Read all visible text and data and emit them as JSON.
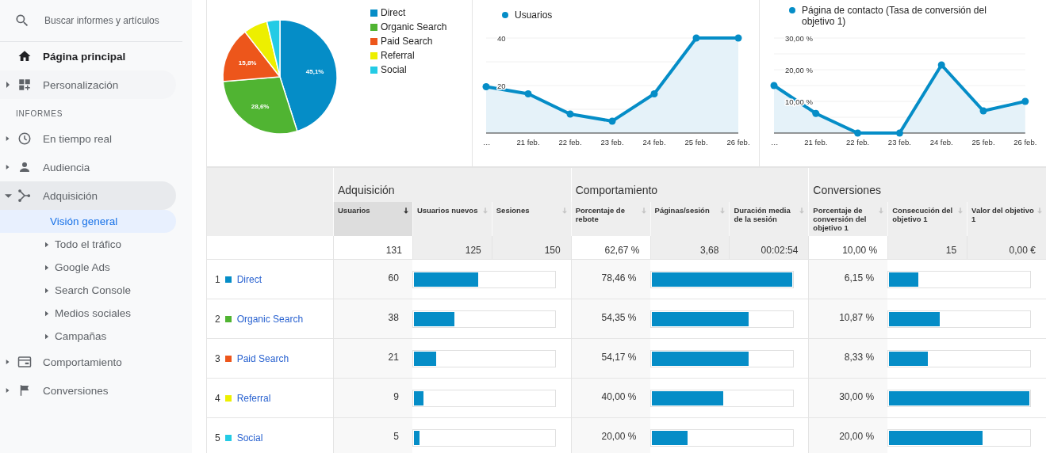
{
  "sidebar": {
    "search": {
      "placeholder": "Buscar informes y artículos"
    },
    "items": [
      {
        "label": "Página principal",
        "kind": "home"
      },
      {
        "label": "Personalización",
        "kind": "custom",
        "expanded": false
      }
    ],
    "section": "INFORMES",
    "reports": [
      {
        "label": "En tiempo real",
        "kind": "realtime",
        "expanded": false
      },
      {
        "label": "Audiencia",
        "kind": "audience",
        "expanded": false
      },
      {
        "label": "Adquisición",
        "kind": "acquisition",
        "expanded": true,
        "children": [
          {
            "label": "Visión general",
            "kind": "page",
            "selected": true
          },
          {
            "label": "Todo el tráfico",
            "kind": "folder",
            "selected": false
          },
          {
            "label": "Google Ads",
            "kind": "folder",
            "selected": false
          },
          {
            "label": "Search Console",
            "kind": "folder",
            "selected": false
          },
          {
            "label": "Medios sociales",
            "kind": "folder",
            "selected": false
          },
          {
            "label": "Campañas",
            "kind": "folder",
            "selected": false
          }
        ]
      },
      {
        "label": "Comportamiento",
        "kind": "behavior",
        "expanded": false
      },
      {
        "label": "Conversiones",
        "kind": "conversions",
        "expanded": false
      }
    ]
  },
  "charts": {
    "pie": {
      "chart_data": {
        "type": "pie",
        "categories": [
          "Direct",
          "Organic Search",
          "Paid Search",
          "Referral",
          "Social"
        ],
        "series": [
          {
            "values": [
              45.1,
              28.6,
              15.8,
              6.8,
              3.7
            ]
          }
        ],
        "legend": true,
        "colors": [
          "#058dc7",
          "#50b432",
          "#ed561b",
          "#edef00",
          "#24cbe5"
        ],
        "value_labels": [
          "45,1%",
          "28,6%",
          "15,8%",
          null,
          null
        ]
      }
    },
    "users": {
      "chart_data": {
        "type": "area",
        "categories": [
          "…",
          "21 feb.",
          "22 feb.",
          "23 feb.",
          "24 feb.",
          "25 feb.",
          "26 feb."
        ],
        "series": [
          {
            "name": "Usuarios",
            "color": "#058dc7",
            "values": [
              19.5,
              16.5,
              8,
              5,
              16.5,
              40,
              40
            ]
          }
        ],
        "ylim": [
          0,
          40
        ],
        "yticks": [
          {
            "value": 20,
            "label": "20"
          },
          {
            "value": 40,
            "label": "40"
          }
        ]
      }
    },
    "conversion": {
      "chart_data": {
        "type": "area",
        "categories": [
          "…",
          "21 feb.",
          "22 feb.",
          "23 feb.",
          "24 feb.",
          "25 feb.",
          "26 feb."
        ],
        "series": [
          {
            "name": "Página de contacto (Tasa de conversión del objetivo 1)",
            "color": "#058dc7",
            "values": [
              15,
              6.2,
              0,
              0,
              21.5,
              7,
              10
            ]
          }
        ],
        "ylim": [
          0,
          30
        ],
        "yticks": [
          {
            "value": 10,
            "label": "10,00 %"
          },
          {
            "value": 20,
            "label": "20,00 %"
          },
          {
            "value": 30,
            "label": "30,00 %"
          }
        ]
      }
    }
  },
  "table": {
    "groups": [
      {
        "label": "Adquisición"
      },
      {
        "label": "Comportamiento"
      },
      {
        "label": "Conversiones"
      }
    ],
    "columns": [
      {
        "label": "Usuarios",
        "sorted": true,
        "selected": true
      },
      {
        "label": "Usuarios nuevos",
        "sorted": false,
        "selected": false
      },
      {
        "label": "Sesiones",
        "sorted": false,
        "selected": false
      },
      {
        "label": "Porcentaje de rebote",
        "sorted": false,
        "selected": true
      },
      {
        "label": "Páginas/sesión",
        "sorted": false,
        "selected": false
      },
      {
        "label": "Duración media de la sesión",
        "sorted": false,
        "selected": false
      },
      {
        "label": "Porcentaje de conversión del objetivo 1",
        "sorted": false,
        "selected": true
      },
      {
        "label": "Consecución del objetivo 1",
        "sorted": false,
        "selected": false
      },
      {
        "label": "Valor del objetivo 1",
        "sorted": false,
        "selected": false
      }
    ],
    "totals": [
      "131",
      "125",
      "150",
      "62,67 %",
      "3,68",
      "00:02:54",
      "10,00 %",
      "15",
      "0,00 €"
    ],
    "rows": [
      {
        "rank": "1",
        "channel": "Direct",
        "color": "#058dc7",
        "cells": [
          {
            "value": "60",
            "level": 0.458
          },
          {
            "value": "78,46 %",
            "level": 1
          },
          {
            "value": "6,15 %",
            "level": 0.205
          }
        ]
      },
      {
        "rank": "2",
        "channel": "Organic Search",
        "color": "#50b432",
        "cells": [
          {
            "value": "38",
            "level": 0.29
          },
          {
            "value": "54,35 %",
            "level": 0.693
          },
          {
            "value": "10,87 %",
            "level": 0.362
          }
        ]
      },
      {
        "rank": "3",
        "channel": "Paid Search",
        "color": "#ed561b",
        "cells": [
          {
            "value": "21",
            "level": 0.16
          },
          {
            "value": "54,17 %",
            "level": 0.69
          },
          {
            "value": "8,33 %",
            "level": 0.278
          }
        ]
      },
      {
        "rank": "4",
        "channel": "Referral",
        "color": "#edef00",
        "cells": [
          {
            "value": "9",
            "level": 0.069
          },
          {
            "value": "40,00 %",
            "level": 0.51
          },
          {
            "value": "30,00 %",
            "level": 1
          }
        ]
      },
      {
        "rank": "5",
        "channel": "Social",
        "color": "#24cbe5",
        "cells": [
          {
            "value": "5",
            "level": 0.038
          },
          {
            "value": "20,00 %",
            "level": 0.255
          },
          {
            "value": "20,00 %",
            "level": 0.667
          }
        ]
      }
    ]
  }
}
